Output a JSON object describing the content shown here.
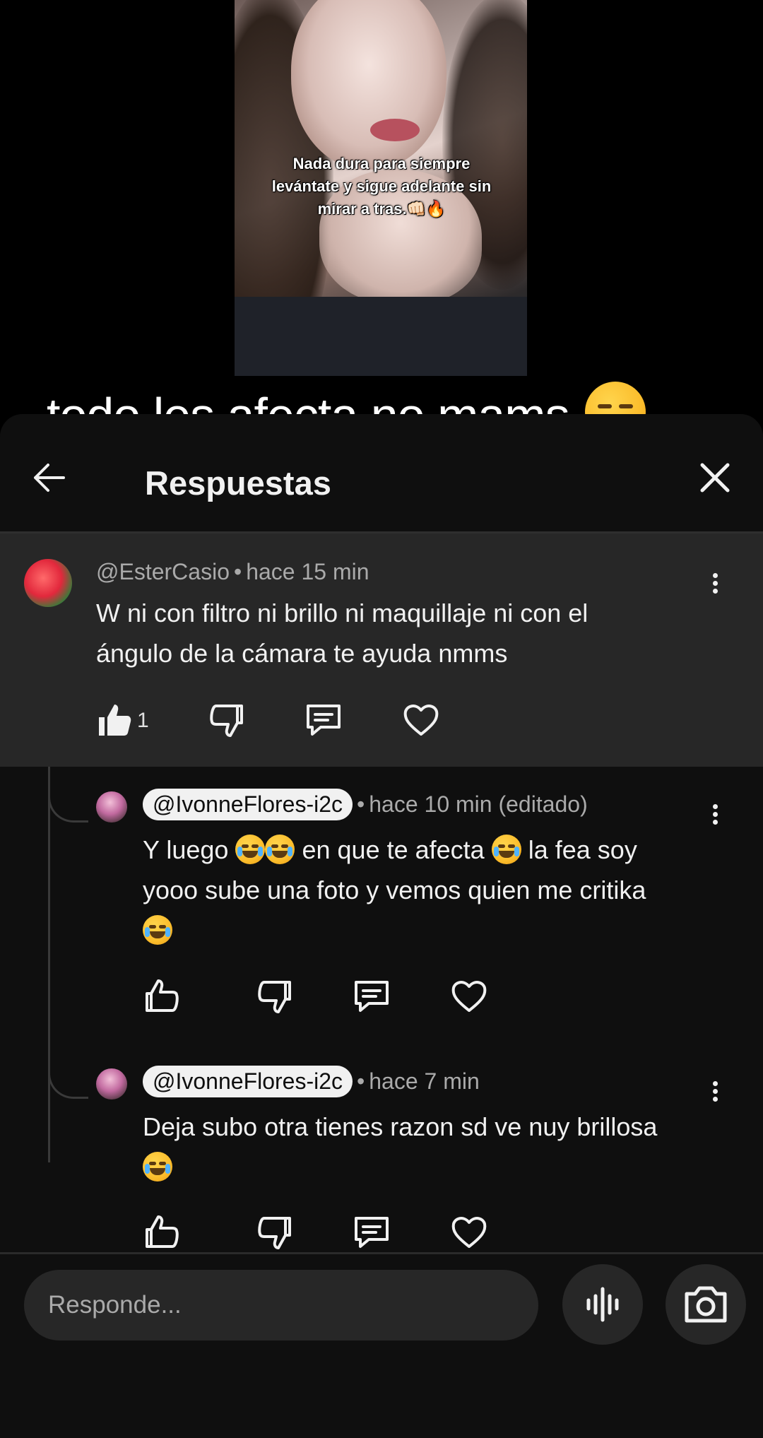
{
  "video": {
    "caption": "Nada dura para siempre levántate y sigue adelante sin mirar a tras.👊🏻🔥"
  },
  "overlay_text": "todo les afecta no mams.",
  "header": {
    "title": "Respuestas",
    "back_icon": "arrow-left-icon",
    "close_icon": "close-icon"
  },
  "parent_comment": {
    "author": "@EsterCasio",
    "separator": "•",
    "time": "hace 15 min",
    "text_line1": "W ni con filtro ni brillo ni maquillaje ni con el",
    "text_line2": "ángulo de la cámara te ayuda nmms",
    "like_count": "1"
  },
  "replies": [
    {
      "author": "@IvonneFlores-i2c",
      "separator": "•",
      "time": "hace 10 min (editado)",
      "text_a": "Y luego",
      "text_b": "en que te afecta",
      "text_c": "la fea soy",
      "text_line2": "yooo sube una foto y vemos quien me critika"
    },
    {
      "author": "@IvonneFlores-i2c",
      "separator": "•",
      "time": "hace 7 min",
      "text_line1": "Deja subo otra tienes razon sd ve nuy brillosa"
    }
  ],
  "composer": {
    "placeholder": "Responde...",
    "mic_icon": "voice-icon",
    "camera_icon": "camera-icon"
  },
  "colors": {
    "sheet_bg": "#0f0f0f",
    "highlight_bg": "#272727",
    "meta_text": "#aaaaaa"
  }
}
